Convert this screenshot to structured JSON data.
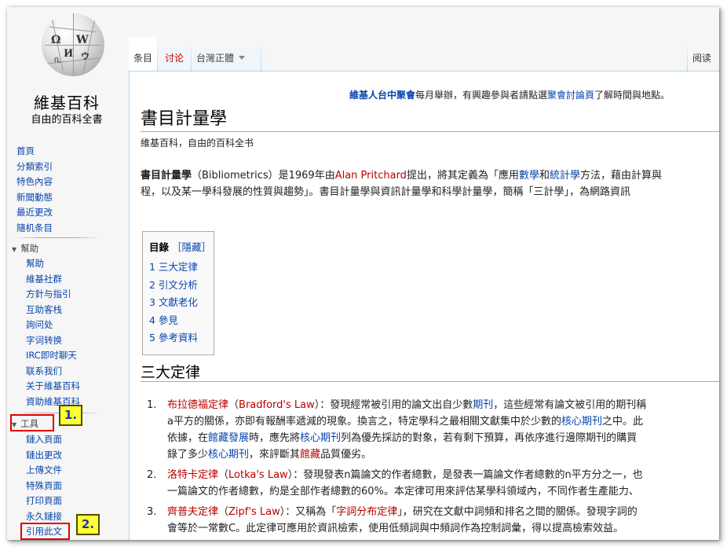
{
  "logo": {
    "title": "維基百科",
    "subtitle": "自由的百科全書"
  },
  "nav": {
    "items": [
      {
        "label": "首頁"
      },
      {
        "label": "分類索引"
      },
      {
        "label": "特色內容"
      },
      {
        "label": "新聞動態"
      },
      {
        "label": "最近更改"
      },
      {
        "label": "隨机条目"
      }
    ]
  },
  "help_portal": {
    "heading": "幫助",
    "items": [
      {
        "label": "幫助"
      },
      {
        "label": "維基社群"
      },
      {
        "label": "方針与指引"
      },
      {
        "label": "互助客栈"
      },
      {
        "label": "詢问处"
      },
      {
        "label": "字词转换"
      },
      {
        "label": "IRC即时聊天"
      },
      {
        "label": "联系我们"
      },
      {
        "label": "关于維基百科"
      },
      {
        "label": "資助維基百科"
      }
    ]
  },
  "tools_portal": {
    "heading": "工具",
    "items": [
      {
        "label": "鏈入頁面"
      },
      {
        "label": "鏈出更改"
      },
      {
        "label": "上傳文件"
      },
      {
        "label": "特殊頁面"
      },
      {
        "label": "打印頁面"
      },
      {
        "label": "永久鏈接"
      },
      {
        "label": "引用此文"
      }
    ]
  },
  "tabs": {
    "article": "条目",
    "talk": "讨论",
    "variant": "台灣正體",
    "read": "阅读"
  },
  "sitenotice": {
    "link1": "維基人台中聚會",
    "text1": "每月舉辦，有興趣參與者請點選",
    "link2": "聚會討論頁",
    "text2": "了解時間與地點。"
  },
  "article": {
    "title": "書目計量學",
    "tagline": "維基百科，自由的百科全书",
    "intro_line1": {
      "bold": "書目計量學",
      "t1": "（Bibliometrics）是1969年由",
      "link_red": "Alan Pritchard",
      "t2": "提出，將其定義為「應用",
      "link1": "數學",
      "t3": "和",
      "link2": "統計學",
      "t4": "方法，藉由計算與"
    },
    "intro_line2": "程，以及某一學科發展的性質與趨勢」。書目計量學與資訊計量學和科學計量學，簡稱「三計學」，為網路資訊"
  },
  "toc": {
    "title": "目錄",
    "hide": "［隱藏］",
    "items": [
      {
        "label": "1 三大定律"
      },
      {
        "label": "2 引文分析"
      },
      {
        "label": "3 文獻老化"
      },
      {
        "label": "4 參見"
      },
      {
        "label": "5 參考資料"
      }
    ]
  },
  "section": {
    "heading": "三大定律"
  },
  "laws": {
    "law1": {
      "num": "1.",
      "l1_link": "布拉德福定律",
      "l1_paren_link": "Bradford's Law",
      "l1_text": "：發現經常被引用的論文出自少數",
      "l1_link2": "期刊",
      "l1_text2": "，這些經常有論文被引用的期刊稱",
      "l2_text": "a平方的關係，亦即有報酬率遞減的現象。換言之，特定學科之最相關文獻集中於少數的",
      "l2_link": "核心期刊",
      "l2_text2": "之中。此",
      "l3_text": "依據，在",
      "l3_link": "館藏發展",
      "l3_text2": "時，應先將",
      "l3_link2": "核心期刊",
      "l3_text3": "列為優先採訪的對象，若有剩下預算，再依序進行邊際期刊的購買",
      "l4_text": "錄了多少",
      "l4_link": "核心期刊",
      "l4_text2": "，來評斷其",
      "l4_link2": "館藏",
      "l4_text3": "品質優劣。"
    },
    "law2": {
      "num": "2.",
      "l1_link": "洛特卡定律",
      "l1_paren_link": "Lotka's Law",
      "l1_text": "：發現發表n篇論文的作者總數，是發表一篇論文作者總數的n平方分之一，也",
      "l2_text": "一篇論文的作者總數，約是全部作者總數的60%。本定律可用來評估某學科領域內，不同作者生產能力、"
    },
    "law3": {
      "num": "3.",
      "l1_link": "齊普夫定律",
      "l1_paren_link": "Zipf's Law",
      "l1_text": "：又稱為「",
      "l1_link2": "字詞分布定律",
      "l1_text2": "」，研究在文獻中詞頻和排名之間的關係。發現字詞的",
      "l2_text": "會等於一常數C。此定律可應用於資訊檢索，使用低頻詞與中頻詞作為控制詞彙，得以提高檢索效益。"
    }
  },
  "annotations": {
    "tag1": "1.",
    "tag2": "2."
  },
  "colors": {
    "link": "#0645ad",
    "redlink": "#ba0000",
    "highlight_box": "#e00000",
    "tag_bg": "#ffff33",
    "tag_text": "#1a3aa0"
  }
}
